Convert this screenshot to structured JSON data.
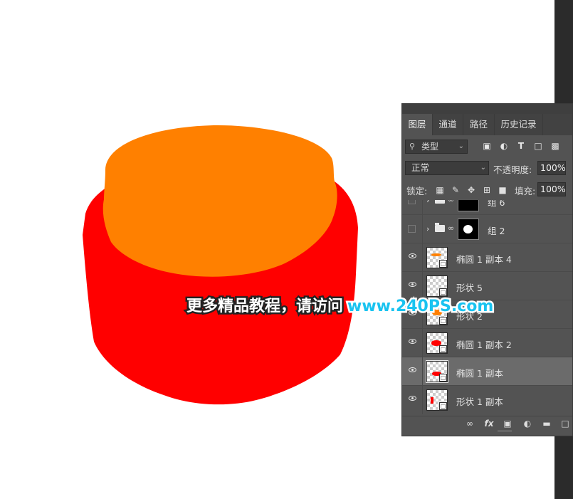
{
  "canvas": {
    "colors": {
      "orange": "#ff8000",
      "red": "#ff0000"
    }
  },
  "panel": {
    "tabs": [
      "图层",
      "通道",
      "路径",
      "历史记录"
    ],
    "filter": {
      "label": "类型",
      "icons": [
        "image-filter-icon",
        "adjustment-filter-icon",
        "text-filter-icon",
        "shape-filter-icon",
        "smart-object-filter-icon"
      ]
    },
    "blend_mode": "正常",
    "opacity_label": "不透明度:",
    "opacity_value": "100%",
    "lock_label": "锁定:",
    "fill_label": "填充:",
    "fill_value": "100%",
    "layers": [
      {
        "name": "组 6",
        "type": "group",
        "visible": false
      },
      {
        "name": "组 2",
        "type": "group",
        "visible": false
      },
      {
        "name": "椭圆 1 副本 4",
        "type": "shape",
        "visible": true,
        "thumb_color": "#ff8000"
      },
      {
        "name": "形状 5",
        "type": "shape",
        "visible": true,
        "thumb_color": ""
      },
      {
        "name": "形状 2",
        "type": "shape",
        "visible": true,
        "thumb_color": "#ff8000"
      },
      {
        "name": "椭圆 1 副本 2",
        "type": "shape",
        "visible": true,
        "thumb_color": "#ff0000"
      },
      {
        "name": "椭圆 1 副本",
        "type": "shape",
        "visible": true,
        "thumb_color": "#ff0000",
        "selected": true
      },
      {
        "name": "形状 1 副本",
        "type": "shape",
        "visible": true,
        "thumb_color": "#ff0000"
      }
    ],
    "footer_icons": [
      "link-layers-icon",
      "fx-icon",
      "add-mask-icon",
      "adjustment-layer-icon",
      "new-group-icon",
      "new-layer-icon"
    ],
    "fx_label": "fx"
  },
  "watermark": {
    "text_cn": "更多精品教程，请访问",
    "text_url": "www.240PS.com"
  }
}
